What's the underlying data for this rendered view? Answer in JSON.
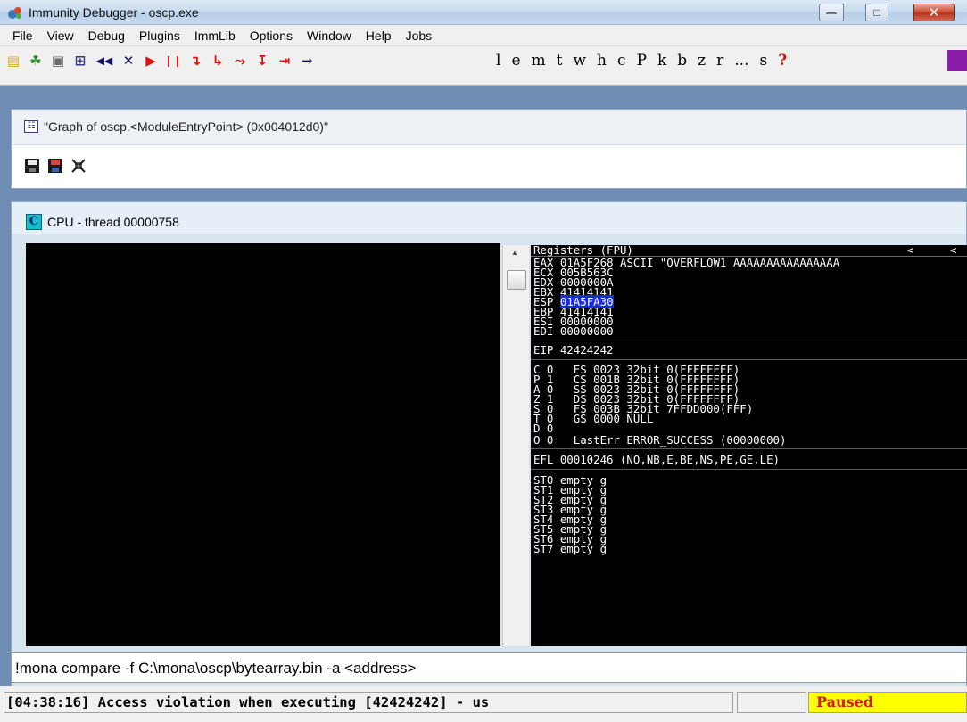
{
  "window": {
    "title": "Immunity Debugger - oscp.exe",
    "minimize": "—",
    "maximize": "□",
    "close": "✕"
  },
  "menu": [
    "File",
    "View",
    "Debug",
    "Plugins",
    "ImmLib",
    "Options",
    "Window",
    "Help",
    "Jobs"
  ],
  "toolbar": {
    "icons": [
      "open-icon",
      "process-icon",
      "terminate-icon",
      "graph-icon",
      "rewind-icon",
      "close-icon",
      "run-icon",
      "pause-icon",
      "step-into-icon",
      "step-over-icon",
      "trace-into-icon",
      "trace-over-icon",
      "execute-till-return-icon",
      "goto-icon"
    ],
    "glyphs": [
      "▤",
      "☘",
      "▣",
      "⊞",
      "◀◀",
      "✕",
      "▶",
      "❙❙",
      "↴",
      "↳",
      "⤳",
      "↧",
      "⇥",
      "⇾"
    ],
    "letters": [
      "l",
      "e",
      "m",
      "t",
      "w",
      "h",
      "c",
      "P",
      "k",
      "b",
      "z",
      "r",
      "...",
      "s",
      "?"
    ],
    "accent": "#8a1ea8"
  },
  "graph_window": {
    "title": "\"Graph of oscp.<ModuleEntryPoint> (0x004012d0)\"",
    "icons": [
      "save-icon",
      "save-as-icon",
      "collapse-icon"
    ]
  },
  "cpu_window": {
    "icon_letter": "C",
    "title": "CPU - thread 00000758"
  },
  "registers": {
    "header": "Registers (FPU)",
    "header_arrows": [
      "<",
      "<"
    ],
    "general": [
      {
        "name": "EAX",
        "value": "01A5F268",
        "info": "ASCII \"OVERFLOW1 AAAAAAAAAAAAAAAA"
      },
      {
        "name": "ECX",
        "value": "005B563C",
        "info": ""
      },
      {
        "name": "EDX",
        "value": "0000000A",
        "info": ""
      },
      {
        "name": "EBX",
        "value": "41414141",
        "info": ""
      },
      {
        "name": "ESP",
        "value": "01A5FA30",
        "info": "",
        "highlight": true
      },
      {
        "name": "EBP",
        "value": "41414141",
        "info": ""
      },
      {
        "name": "ESI",
        "value": "00000000",
        "info": ""
      },
      {
        "name": "EDI",
        "value": "00000000",
        "info": ""
      }
    ],
    "eip": "EIP 42424242",
    "flags": [
      "C 0   ES 0023 32bit 0(FFFFFFFF)",
      "P 1   CS 001B 32bit 0(FFFFFFFF)",
      "A 0   SS 0023 32bit 0(FFFFFFFF)",
      "Z 1   DS 0023 32bit 0(FFFFFFFF)",
      "S 0   FS 003B 32bit 7FFDD000(FFF)",
      "T 0   GS 0000 NULL",
      "D 0",
      "O 0   LastErr ERROR_SUCCESS (00000000)"
    ],
    "efl": "EFL 00010246 (NO,NB,E,BE,NS,PE,GE,LE)",
    "fpu": [
      "ST0 empty g",
      "ST1 empty g",
      "ST2 empty g",
      "ST3 empty g",
      "ST4 empty g",
      "ST5 empty g",
      "ST6 empty g",
      "ST7 empty g"
    ]
  },
  "command_bar": {
    "value": "!mona compare -f C:\\mona\\oscp\\bytearray.bin -a <address>"
  },
  "status": {
    "message": "[04:38:16] Access violation when executing [42424242] - us",
    "state": "Paused",
    "state_color": "#d21b1b",
    "state_background": "#ffff00"
  }
}
